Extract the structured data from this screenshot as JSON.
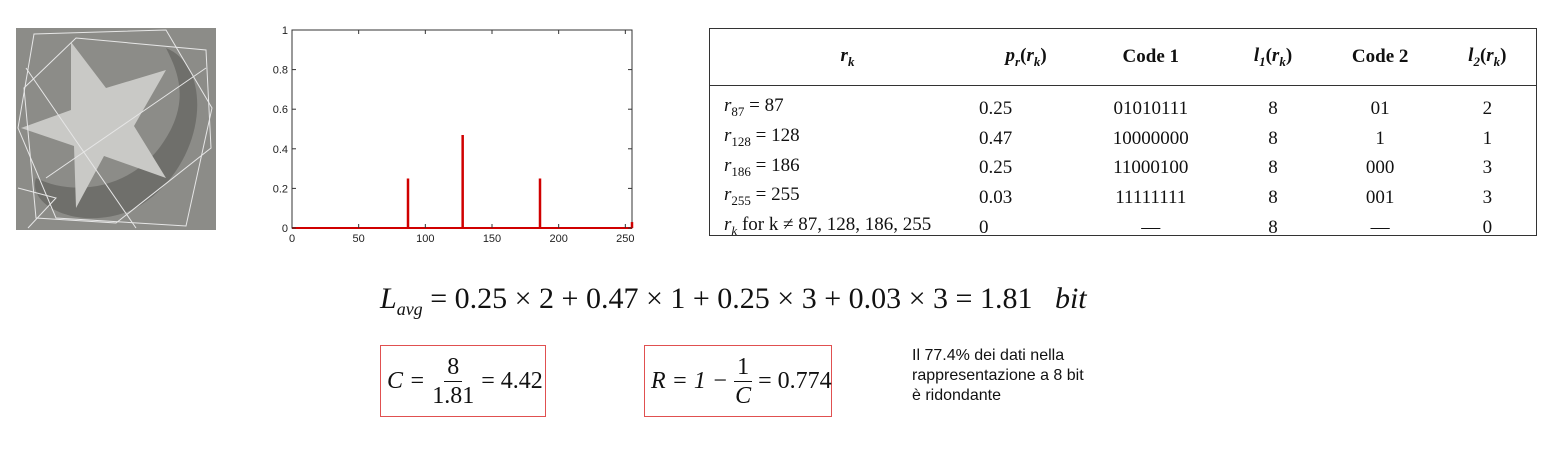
{
  "chart_data": {
    "type": "bar",
    "x": [
      87,
      128,
      186,
      255
    ],
    "values": [
      0.25,
      0.47,
      0.25,
      0.03
    ],
    "xlim": [
      0,
      255
    ],
    "ylim": [
      0,
      1
    ],
    "xticks": [
      "0",
      "50",
      "100",
      "150",
      "200",
      "250"
    ],
    "yticks": [
      "0",
      "0.2",
      "0.4",
      "0.6",
      "0.8",
      "1"
    ],
    "xlabel": "",
    "ylabel": "",
    "title": "",
    "grid": false,
    "color": "#d00000"
  },
  "table": {
    "headers": [
      "r_k",
      "p_r(r_k)",
      "Code 1",
      "l_1(r_k)",
      "Code 2",
      "l_2(r_k)"
    ],
    "rows": [
      {
        "r_sub": "87",
        "r_val": "= 87",
        "p": "0.25",
        "code1": "01010111",
        "l1": "8",
        "code2": "01",
        "l2": "2"
      },
      {
        "r_sub": "128",
        "r_val": "= 128",
        "p": "0.47",
        "code1": "10000000",
        "l1": "8",
        "code2": "1",
        "l2": "1"
      },
      {
        "r_sub": "186",
        "r_val": "= 186",
        "p": "0.25",
        "code1": "11000100",
        "l1": "8",
        "code2": "000",
        "l2": "3"
      },
      {
        "r_sub": "255",
        "r_val": "= 255",
        "p": "0.03",
        "code1": "11111111",
        "l1": "8",
        "code2": "001",
        "l2": "3"
      },
      {
        "r_sub": "k",
        "r_val": "for k ≠ 87, 128, 186, 255",
        "p": "0",
        "code1": "—",
        "l1": "8",
        "code2": "—",
        "l2": "0"
      }
    ]
  },
  "formulas": {
    "lavg_label": "L",
    "lavg_sub": "avg",
    "lavg_expr": "= 0.25 × 2 + 0.47 × 1 + 0.25 × 3 + 0.03 × 3 = 1.81",
    "lavg_unit": "bit",
    "c_label": "C =",
    "c_num": "8",
    "c_den": "1.81",
    "c_result": "= 4.42",
    "r_label": "R = 1 −",
    "r_num": "1",
    "r_den": "C",
    "r_result": "= 0.774"
  },
  "note": {
    "line1": "Il 77.4% dei dati nella",
    "line2": "rappresentazione a 8 bit",
    "line3": "è ridondante"
  },
  "colors": {
    "bar": "#d00000",
    "formula_box_border": "#e05050",
    "image_background": "#8c8c88"
  }
}
